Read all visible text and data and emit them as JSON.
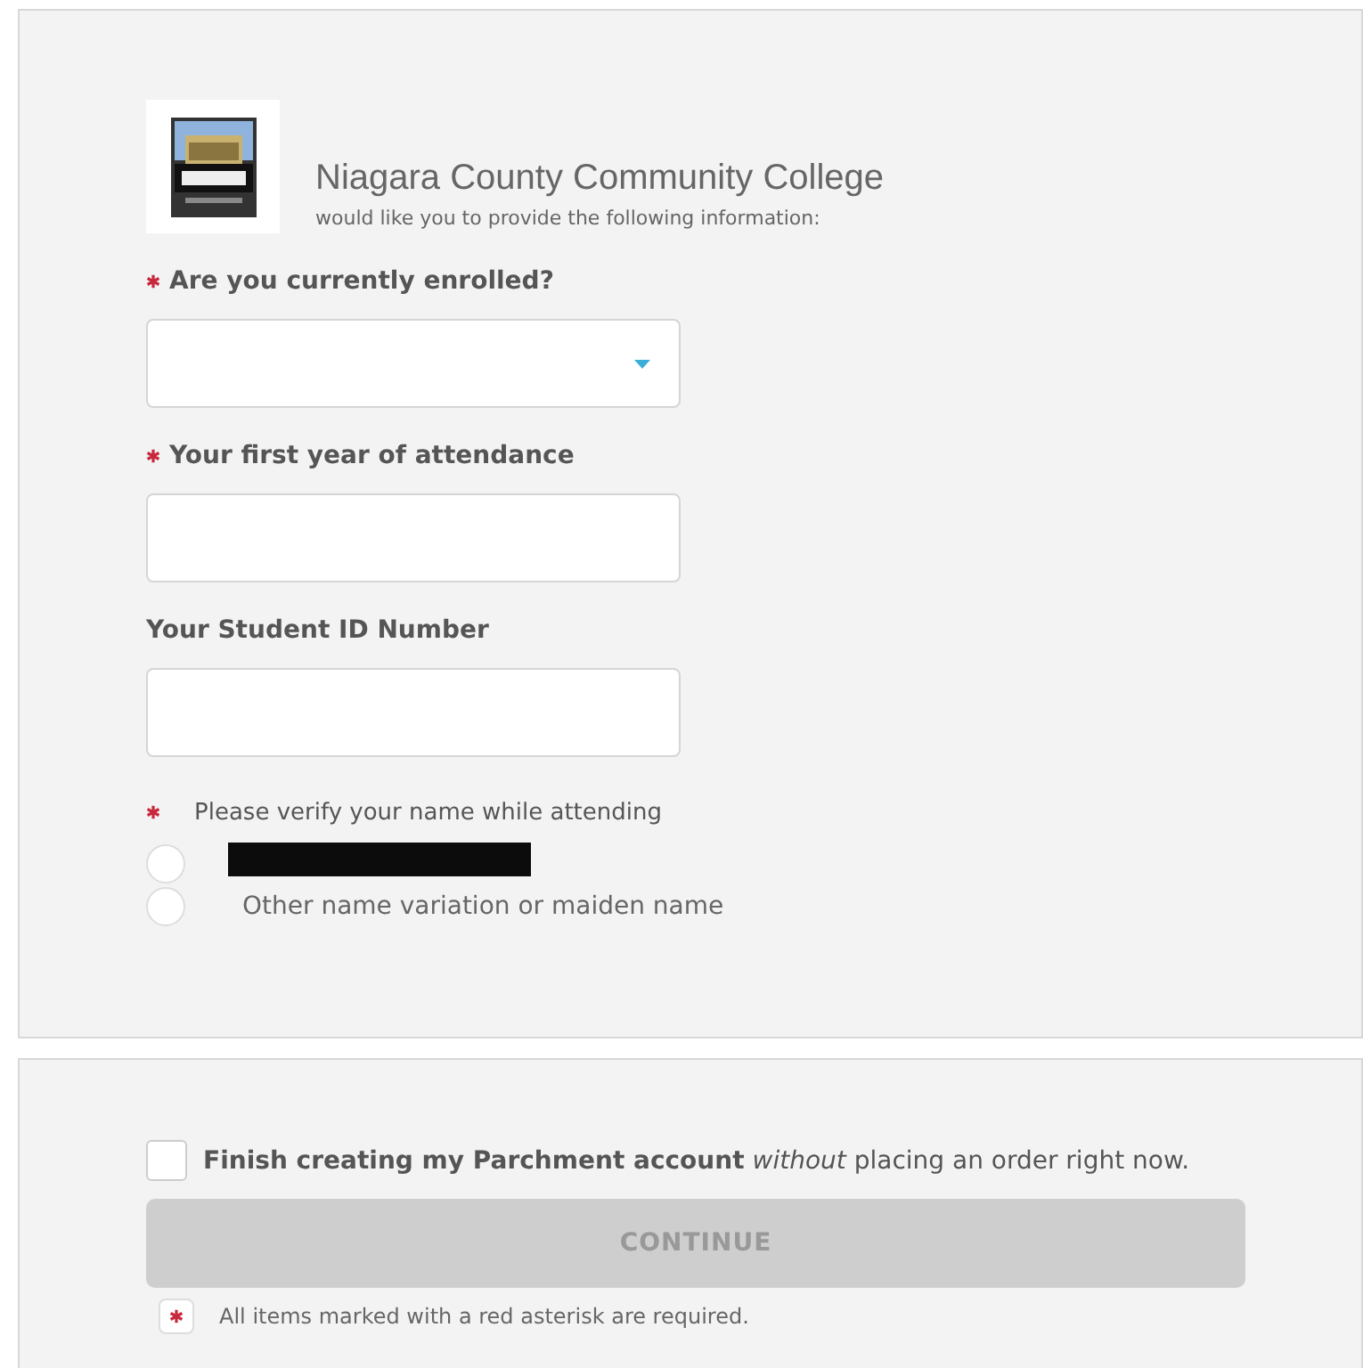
{
  "header": {
    "college": "Niagara County Community College",
    "subtitle": "would like you to provide the following information:"
  },
  "questions": [
    {
      "kind": "select",
      "label": "Are you currently enrolled?",
      "required": true
    },
    {
      "kind": "text",
      "label": "Your first year of attendance",
      "required": true
    },
    {
      "kind": "text",
      "label": "Your Student ID Number",
      "required": false
    },
    {
      "kind": "radio",
      "label": "Please verify your name while attending",
      "required": true,
      "options": [
        {
          "kind": "redacted",
          "selected": false
        },
        {
          "kind": "text",
          "label": "Other name variation or maiden name",
          "selected": false
        }
      ]
    }
  ],
  "footer": {
    "checkbox": {
      "label": "**Finish creating my Parchment account** *without* placing an order right now.",
      "checked": false
    },
    "button": {
      "label": "CONTINUE",
      "disabled": true
    },
    "note": "All items marked with a red asterisk are required."
  }
}
